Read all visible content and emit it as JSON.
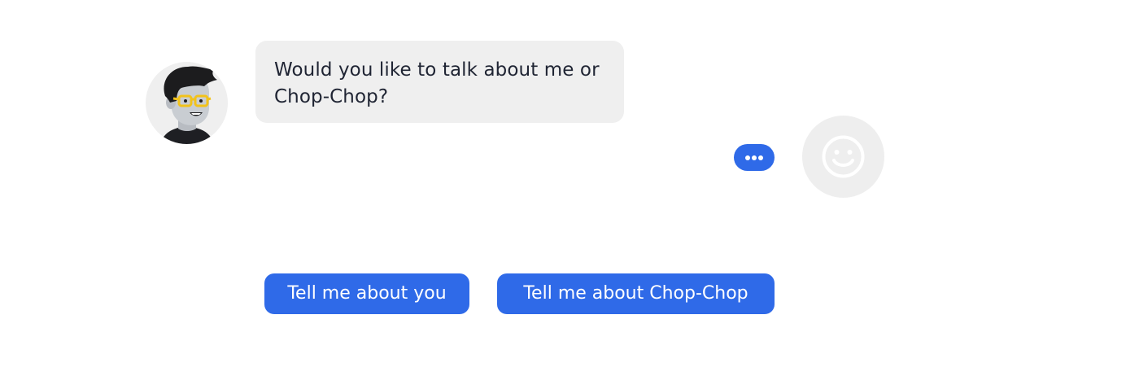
{
  "conversation": {
    "bot_message": "Would you like to talk about me or Chop-Chop?",
    "bot_avatar_icon": "cartoon-man-with-yellow-glasses",
    "typing_indicator_icon": "ellipsis-icon",
    "user_avatar_icon": "smiley-face-icon"
  },
  "quick_replies": [
    {
      "label": "Tell me about you"
    },
    {
      "label": "Tell me about Chop-Chop"
    }
  ],
  "colors": {
    "accent": "#2f6ae8",
    "bubble_background": "#efefef",
    "text": "#1f2433",
    "button_text": "#ffffff"
  }
}
